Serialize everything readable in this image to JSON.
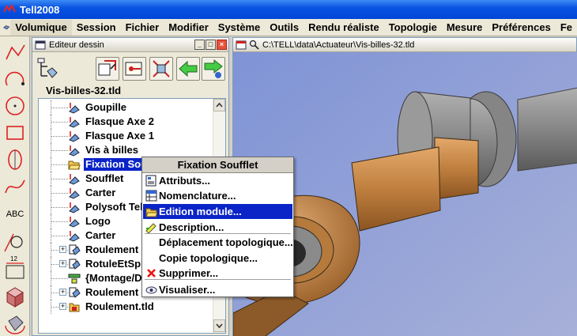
{
  "app": {
    "title": "Tell2008"
  },
  "menu": [
    "Volumique",
    "Session",
    "Fichier",
    "Modifier",
    "Système",
    "Outils",
    "Rendu réaliste",
    "Topologie",
    "Mesure",
    "Préférences",
    "Fe"
  ],
  "editor": {
    "title": "Editeur dessin",
    "root_label": "Vis-billes-32.tld",
    "tree": [
      {
        "label": "Goupille",
        "icon": "part-icon",
        "expandable": false
      },
      {
        "label": "Flasque Axe 2",
        "icon": "part-icon",
        "expandable": false
      },
      {
        "label": "Flasque Axe 1",
        "icon": "part-icon",
        "expandable": false
      },
      {
        "label": "Vis à billes",
        "icon": "part-icon",
        "expandable": false
      },
      {
        "label": "Fixation Soufflet",
        "icon": "open-folder-icon",
        "expandable": false,
        "selected": true
      },
      {
        "label": "Soufflet",
        "icon": "part-icon",
        "expandable": false
      },
      {
        "label": "Carter",
        "icon": "part-icon",
        "expandable": false
      },
      {
        "label": "Polysoft Tel",
        "icon": "part-icon",
        "expandable": false
      },
      {
        "label": "Logo",
        "icon": "part-icon",
        "expandable": false
      },
      {
        "label": "Carter",
        "icon": "part-icon",
        "expandable": false
      },
      {
        "label": "Roulement",
        "icon": "assembly-icon",
        "expandable": true
      },
      {
        "label": "RotuleEtSpl",
        "icon": "assembly-icon",
        "expandable": true
      },
      {
        "label": "{Montage/De",
        "icon": "constraint-icon",
        "expandable": false
      },
      {
        "label": "Roulement c",
        "icon": "assembly-icon",
        "expandable": true
      },
      {
        "label": "Roulement.tld",
        "icon": "file-icon",
        "expandable": true
      }
    ]
  },
  "viewport": {
    "title": "C:\\TELL\\data\\Actuateur\\Vis-billes-32.tld"
  },
  "context_menu": {
    "title": "Fixation Soufflet",
    "items": [
      {
        "label": "Attributs...",
        "icon": "attributes-icon"
      },
      {
        "label": "Nomenclature...",
        "icon": "nomenclature-icon"
      },
      {
        "label": "Edition module...",
        "icon": "open-folder-icon",
        "highlighted": true
      },
      {
        "label": "Description...",
        "icon": "description-icon"
      },
      {
        "label": "Déplacement topologique...",
        "icon": ""
      },
      {
        "label": "Copie topologique...",
        "icon": ""
      },
      {
        "label": "Supprimer...",
        "icon": "delete-icon"
      },
      {
        "label": "Visualiser...",
        "icon": "eye-icon"
      }
    ]
  },
  "left_toolbar": [
    "polyline-icon",
    "arc-icon",
    "circle-icon",
    "rectangle-icon",
    "ellipse-icon",
    "spline-icon",
    "text-icon",
    "dimension-icon",
    "length-icon",
    "solid-box-icon",
    "solid-rotate-icon"
  ],
  "left_toolbar_text": {
    "text_tool": "ABC",
    "length_value": "12"
  }
}
